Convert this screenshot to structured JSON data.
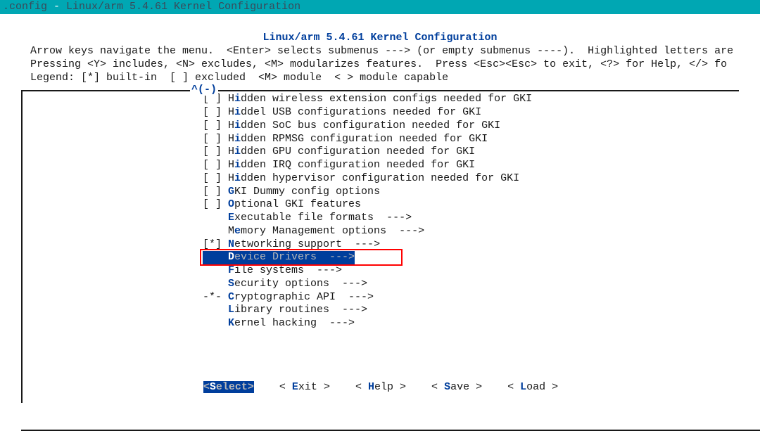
{
  "titlebar": {
    "prefix": ".config",
    "sep": " - ",
    "title": "Linux/arm 5.4.61 Kernel Configuration"
  },
  "header": {
    "title": "Linux/arm 5.4.61 Kernel Configuration"
  },
  "instructions_line1": " Arrow keys navigate the menu.  <Enter> selects submenus ---> (or empty submenus ----).  Highlighted letters are",
  "instructions_line2": " Pressing <Y> includes, <N> excludes, <M> modularizes features.  Press <Esc><Esc> to exit, <?> for Help, </> fo",
  "instructions_line3": " Legend: [*] built-in  [ ] excluded  <M> module  < > module capable",
  "scroll_indicator": "^(-)",
  "menu_items": [
    {
      "prefix": "[ ] ",
      "hot": "i",
      "before": "H",
      "after": "dden wireless extension configs needed for GKI"
    },
    {
      "prefix": "[ ] ",
      "hot": "i",
      "before": "H",
      "after": "ddel USB configurations needed for GKI"
    },
    {
      "prefix": "[ ] ",
      "hot": "i",
      "before": "H",
      "after": "dden SoC bus configuration needed for GKI"
    },
    {
      "prefix": "[ ] ",
      "hot": "i",
      "before": "H",
      "after": "dden RPMSG configuration needed for GKI"
    },
    {
      "prefix": "[ ] ",
      "hot": "i",
      "before": "H",
      "after": "dden GPU configuration needed for GKI"
    },
    {
      "prefix": "[ ] ",
      "hot": "i",
      "before": "H",
      "after": "dden IRQ configuration needed for GKI"
    },
    {
      "prefix": "[ ] ",
      "hot": "i",
      "before": "H",
      "after": "dden hypervisor configuration needed for GKI"
    },
    {
      "prefix": "[ ] ",
      "hot": "G",
      "before": "",
      "after": "KI Dummy config options"
    },
    {
      "prefix": "[ ] ",
      "hot": "O",
      "before": "",
      "after": "ptional GKI features"
    },
    {
      "prefix": "    ",
      "hot": "E",
      "before": "",
      "after": "xecutable file formats  --->"
    },
    {
      "prefix": "    ",
      "hot": "e",
      "before": "M",
      "after": "mory Management options  --->"
    },
    {
      "prefix": "[*] ",
      "hot": "N",
      "before": "",
      "after": "etworking support  --->"
    }
  ],
  "selected": {
    "prefix": "    ",
    "hot": "D",
    "before": "",
    "after": "evice Drivers  --->"
  },
  "menu_items_after": [
    {
      "prefix": "    ",
      "hot": "F",
      "before": "",
      "after": "ile systems  --->"
    },
    {
      "prefix": "    ",
      "hot": "S",
      "before": "",
      "after": "ecurity options  --->"
    },
    {
      "prefix": "-*- ",
      "hot": "C",
      "before": "",
      "after": "ryptographic API  --->"
    },
    {
      "prefix": "    ",
      "hot": "L",
      "before": "",
      "after": "ibrary routines  --->"
    },
    {
      "prefix": "    ",
      "hot": "K",
      "before": "",
      "after": "ernel hacking  --->"
    }
  ],
  "buttons": {
    "select": {
      "open": "<",
      "hot": "S",
      "rest": "elect",
      "close": ">"
    },
    "exit": {
      "open": "< ",
      "hot": "E",
      "rest": "xit",
      " close": " >"
    },
    "help": {
      "open": "< ",
      "hot": "H",
      "rest": "elp",
      " close": " >"
    },
    "save": {
      "open": "< ",
      "hot": "S",
      "rest": "ave",
      " close": " >"
    },
    "load": {
      "open": "< ",
      "hot": "L",
      "rest": "oad",
      " close": " >"
    }
  }
}
